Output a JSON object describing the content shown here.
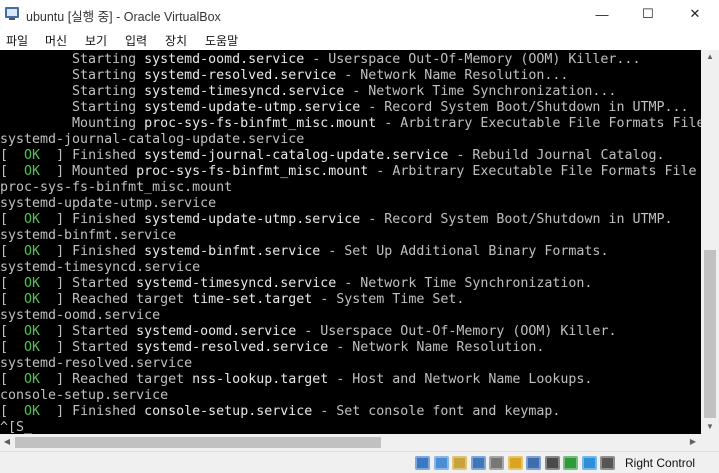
{
  "window": {
    "title": "ubuntu [실행 중] - Oracle VirtualBox",
    "minimize_glyph": "—",
    "maximize_glyph": "☐",
    "close_glyph": "✕"
  },
  "menu": [
    "파일",
    "머신",
    "보기",
    "입력",
    "장치",
    "도움말"
  ],
  "console": {
    "lines": [
      {
        "pre": "         Starting ",
        "unit": "systemd-oomd.service",
        "post": " - Userspace Out-Of-Memory (OOM) Killer..."
      },
      {
        "pre": "         Starting ",
        "unit": "systemd-resolved.service",
        "post": " - Network Name Resolution..."
      },
      {
        "pre": "         Starting ",
        "unit": "systemd-timesyncd.service",
        "post": " - Network Time Synchronization..."
      },
      {
        "pre": "         Starting ",
        "unit": "systemd-update-utmp.service",
        "post": " - Record System Boot/Shutdown in UTMP..."
      },
      {
        "pre": "         Mounting ",
        "unit": "proc-sys-fs-binfmt_misc.mount",
        "post": " - Arbitrary Executable File Formats File"
      },
      {
        "pre": "systemd-journal-catalog-update.service",
        "unit": "",
        "post": ""
      },
      {
        "ok": "OK",
        "pre": "] Finished ",
        "unit": "systemd-journal-catalog-update.service",
        "post": " - Rebuild Journal Catalog."
      },
      {
        "ok": "OK",
        "pre": "] Mounted ",
        "unit": "proc-sys-fs-binfmt_misc.mount",
        "post": " - Arbitrary Executable File Formats File"
      },
      {
        "pre": "proc-sys-fs-binfmt_misc.mount",
        "unit": "",
        "post": ""
      },
      {
        "pre": "systemd-update-utmp.service",
        "unit": "",
        "post": ""
      },
      {
        "ok": "OK",
        "pre": "] Finished ",
        "unit": "systemd-update-utmp.service",
        "post": " - Record System Boot/Shutdown in UTMP."
      },
      {
        "pre": "systemd-binfmt.service",
        "unit": "",
        "post": ""
      },
      {
        "ok": "OK",
        "pre": "] Finished ",
        "unit": "systemd-binfmt.service",
        "post": " - Set Up Additional Binary Formats."
      },
      {
        "pre": "systemd-timesyncd.service",
        "unit": "",
        "post": ""
      },
      {
        "ok": "OK",
        "pre": "] Started ",
        "unit": "systemd-timesyncd.service",
        "post": " - Network Time Synchronization."
      },
      {
        "ok": "OK",
        "pre": "] Reached target ",
        "unit": "time-set.target",
        "post": " - System Time Set."
      },
      {
        "pre": "systemd-oomd.service",
        "unit": "",
        "post": ""
      },
      {
        "ok": "OK",
        "pre": "] Started ",
        "unit": "systemd-oomd.service",
        "post": " - Userspace Out-Of-Memory (OOM) Killer."
      },
      {
        "ok": "OK",
        "pre": "] Started ",
        "unit": "systemd-resolved.service",
        "post": " - Network Name Resolution."
      },
      {
        "pre": "systemd-resolved.service",
        "unit": "",
        "post": ""
      },
      {
        "ok": "OK",
        "pre": "] Reached target ",
        "unit": "nss-lookup.target",
        "post": " - Host and Network Name Lookups."
      },
      {
        "pre": "console-setup.service",
        "unit": "",
        "post": ""
      },
      {
        "ok": "OK",
        "pre": "] Finished ",
        "unit": "console-setup.service",
        "post": " - Set console font and keymap."
      },
      {
        "pre": "^[S_",
        "unit": "",
        "post": ""
      }
    ]
  },
  "status": {
    "icons": [
      "hard-disk-icon",
      "optical-drive-icon",
      "audio-icon",
      "network-icon",
      "usb-icon",
      "shared-folders-icon",
      "display-icon",
      "video-capture-icon",
      "cpu-icon",
      "mouse-integration-icon",
      "keyboard-capture-icon"
    ],
    "host_key": "Right Control"
  },
  "colors": {
    "console_bg": "#000000",
    "console_text": "#c0c0c0",
    "ok_green": "#4cc44c"
  }
}
